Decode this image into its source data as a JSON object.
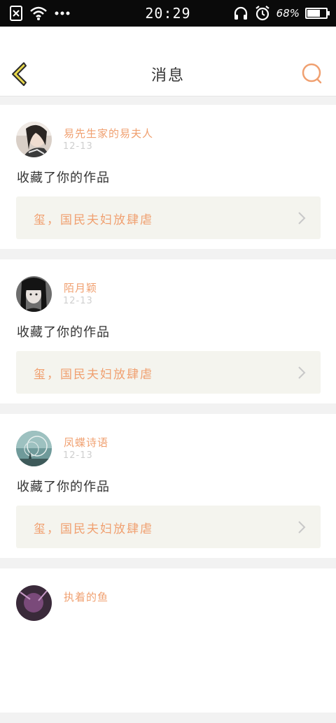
{
  "status_bar": {
    "time": "20:29",
    "battery_percent_label": "68%",
    "battery_level": 0.68,
    "icons": [
      "sim-off-icon",
      "wifi-icon",
      "more-dots-icon",
      "headphones-icon",
      "alarm-icon",
      "battery-icon"
    ]
  },
  "header": {
    "title": "消息",
    "back_icon": "chevron-left-icon",
    "search_icon": "search-icon"
  },
  "colors": {
    "accent": "#f0a070",
    "back_arrow": "#e8d84a",
    "work_box_bg": "#f4f4ee",
    "text_primary": "#333333",
    "text_muted": "#cfcfcf"
  },
  "messages": [
    {
      "username": "易先生家的易夫人",
      "date": "12-13",
      "action": "收藏了你的作品",
      "work_title": "玺，国民夫妇放肆虐",
      "avatar": "avatar-girl-1"
    },
    {
      "username": "陌月颖",
      "date": "12-13",
      "action": "收藏了你的作品",
      "work_title": "玺，国民夫妇放肆虐",
      "avatar": "avatar-girl-2"
    },
    {
      "username": "凤蝶诗语",
      "date": "12-13",
      "action": "收藏了你的作品",
      "work_title": "玺，国民夫妇放肆虐",
      "avatar": "avatar-scene-3"
    },
    {
      "username": "执着的鱼",
      "date": "",
      "action": "",
      "work_title": "",
      "avatar": "avatar-4"
    }
  ]
}
